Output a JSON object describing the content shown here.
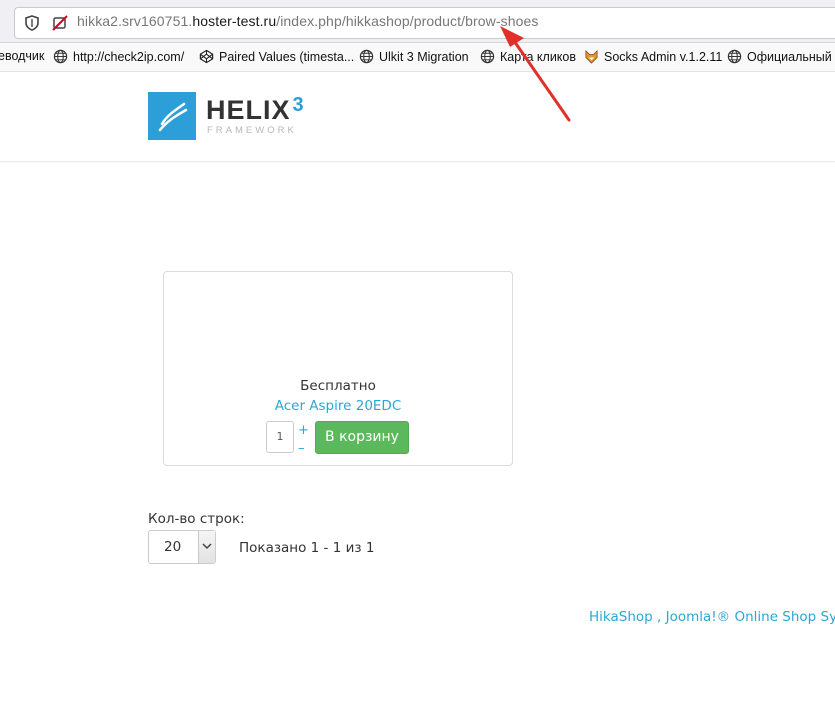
{
  "browser": {
    "url_prefix": "hikka2.srv160751.",
    "url_host": "hoster-test.ru",
    "url_path": "/index.php/hikkashop/product/brow-shoes",
    "bookmarks": [
      {
        "label": "еводчик",
        "icon": "none"
      },
      {
        "label": "http://check2ip.com/",
        "icon": "globe-icon"
      },
      {
        "label": "Paired Values (timesta...",
        "icon": "codepen-icon"
      },
      {
        "label": "Ulkit 3 Migration",
        "icon": "globe-icon"
      },
      {
        "label": "Карта кликов",
        "icon": "globe-icon"
      },
      {
        "label": "Socks Admin v.1.2.11",
        "icon": "fox-icon"
      },
      {
        "label": "Официальный б",
        "icon": "globe-icon"
      }
    ]
  },
  "site": {
    "logo_word": "HELIX",
    "logo_number": "3",
    "logo_sub": "FRAMEWORK"
  },
  "product": {
    "price": "Бесплатно",
    "name": "Acer Aspire 20EDC",
    "quantity": "1",
    "plus": "+",
    "minus": "–",
    "cart_button": "В корзину"
  },
  "pagination": {
    "rows_label": "Кол-во строк:",
    "rows_value": "20",
    "shown_text": "Показано 1 - 1 из 1"
  },
  "footer": {
    "link": "HikaShop , Joomla!® Online Shop Syste"
  },
  "colors": {
    "accent": "#2aa7d6",
    "button": "#5cb85c",
    "logo": "#2d9fd8",
    "annotation": "#e0302a"
  }
}
